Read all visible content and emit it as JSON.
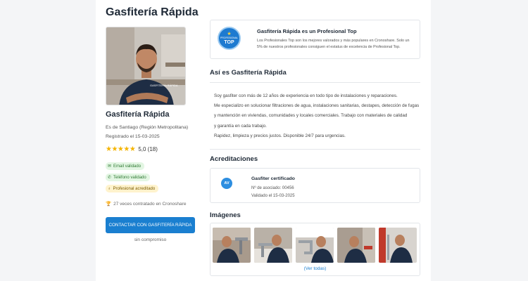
{
  "profile": {
    "title": "Gasfitería Rápida",
    "name": "Gasfitería Rápida",
    "location": "Es de Santiago (Región Metropolitana)",
    "registered": "Registrado el 15-03-2025",
    "stars": "★★★★★",
    "rating": "5,0 (18)",
    "shirt_text": "GASFITERÍA RÁPIDA"
  },
  "badges": {
    "email": "Email validado",
    "phone": "Teléfono validado",
    "pro": "Profesional acreditado"
  },
  "hired": "27 veces contratado en Cronoshare",
  "cta": {
    "label": "CONTACTAR CON GASFITERÍA RÁPIDA",
    "sub": "sin compromiso"
  },
  "top_pro": {
    "badge_line1": "PROFESIONAL",
    "badge_line2": "TOP",
    "title": "Gasfitería Rápida es un Profesional Top",
    "text": "Los Profesionales Top son los mejores valorados y más populares en Cronoshare. Solo un 5% de nuestros profesionales consiguen el estatus de excelencia de Profesional Top."
  },
  "about": {
    "heading": "Así es Gasfitería Rápida",
    "lines": [
      "Soy gasfiter con más de 12 años de experiencia en todo tipo de instalaciones y reparaciones.",
      "Me especializo en solucionar filtraciones de agua, instalaciones sanitarias, destapes, detección de fugas",
      "y mantención en viviendas, comunidades y locales comerciales. Trabajo con materiales de calidad",
      "y garantía en cada trabajo.",
      "Rapidez, limpieza y precios justos. Disponible 24/7 para urgencias."
    ]
  },
  "credentials": {
    "heading": "Acreditaciones",
    "icon_text": "AV",
    "title": "Gasfiter certificado",
    "member": "Nº de asociado: 00456",
    "validated": "Validado el 15-03-2025"
  },
  "images": {
    "heading": "Imágenes",
    "see_all": "(Ver todas)"
  },
  "colors": {
    "accent": "#1a7fd0",
    "star": "#f5b400",
    "badge_green": "#e3f6e3",
    "badge_yellow": "#fff3cd"
  }
}
